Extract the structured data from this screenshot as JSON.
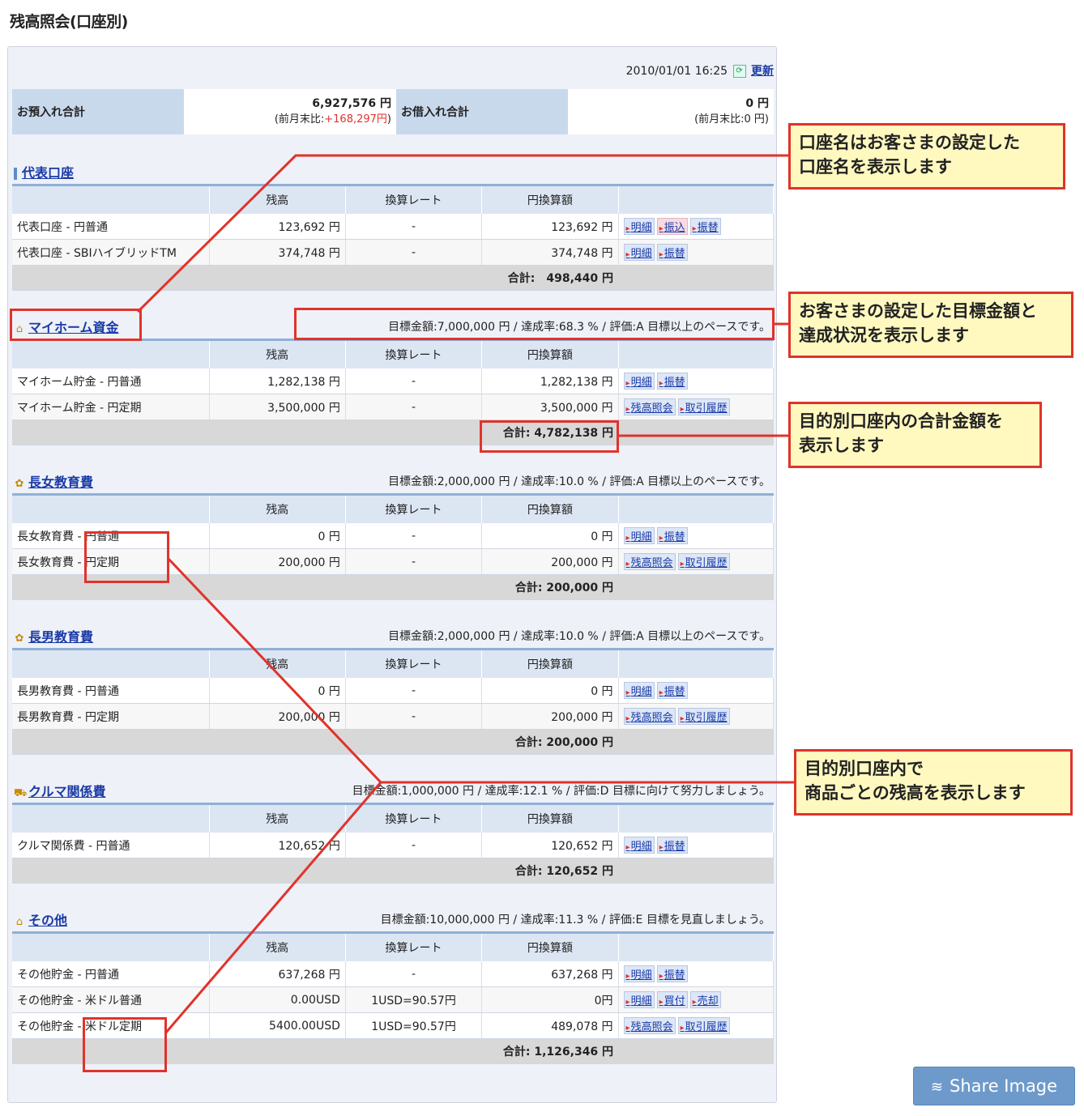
{
  "page": {
    "title": "残高照会(口座別)"
  },
  "topbar": {
    "datetime": "2010/01/01 16:25",
    "refresh_label": "更新"
  },
  "summary": {
    "deposit_label": "お預入れ合計",
    "deposit_value": "6,927,576 円",
    "deposit_change_prefix": "(前月末比:",
    "deposit_change": "+168,297円",
    "deposit_change_suffix": ")",
    "loan_label": "お借入れ合計",
    "loan_value": "0 円",
    "loan_change": "(前月末比:0 円)"
  },
  "columns": [
    "",
    "残高",
    "換算レート",
    "円換算額",
    ""
  ],
  "sections": [
    {
      "name": "代表口座",
      "icon": "bar-marker",
      "goal": "",
      "rows": [
        {
          "name": "代表口座 - 円普通",
          "balance": "123,692 円",
          "rate": "-",
          "yen": "123,692 円",
          "actions": [
            "明細",
            "振込",
            "振替"
          ]
        },
        {
          "name": "代表口座 - SBIハイブリッドTM",
          "balance": "374,748 円",
          "rate": "-",
          "yen": "374,748 円",
          "actions": [
            "明細",
            "振替"
          ]
        }
      ],
      "total": "合計:　498,440 円"
    },
    {
      "name": "マイホーム資金",
      "icon": "house-icon",
      "goal": "目標金額:7,000,000 円 / 達成率:68.3 % / 評価:A 目標以上のペースです。",
      "rows": [
        {
          "name": "マイホーム貯金 - 円普通",
          "balance": "1,282,138 円",
          "rate": "-",
          "yen": "1,282,138 円",
          "actions": [
            "明細",
            "振替"
          ]
        },
        {
          "name": "マイホーム貯金 - 円定期",
          "balance": "3,500,000 円",
          "rate": "-",
          "yen": "3,500,000 円",
          "actions": [
            "残高照会",
            "取引履歴"
          ]
        }
      ],
      "total": "合計: 4,782,138 円"
    },
    {
      "name": "長女教育費",
      "icon": "chick-icon",
      "goal": "目標金額:2,000,000 円 / 達成率:10.0 % / 評価:A 目標以上のペースです。",
      "rows": [
        {
          "name": "長女教育費 - 円普通",
          "balance": "0 円",
          "rate": "-",
          "yen": "0 円",
          "actions": [
            "明細",
            "振替"
          ]
        },
        {
          "name": "長女教育費 - 円定期",
          "balance": "200,000 円",
          "rate": "-",
          "yen": "200,000 円",
          "actions": [
            "残高照会",
            "取引履歴"
          ]
        }
      ],
      "total": "合計: 200,000 円"
    },
    {
      "name": "長男教育費",
      "icon": "chick-icon",
      "goal": "目標金額:2,000,000 円 / 達成率:10.0 % / 評価:A 目標以上のペースです。",
      "rows": [
        {
          "name": "長男教育費 - 円普通",
          "balance": "0 円",
          "rate": "-",
          "yen": "0 円",
          "actions": [
            "明細",
            "振替"
          ]
        },
        {
          "name": "長男教育費 - 円定期",
          "balance": "200,000 円",
          "rate": "-",
          "yen": "200,000 円",
          "actions": [
            "残高照会",
            "取引履歴"
          ]
        }
      ],
      "total": "合計: 200,000 円"
    },
    {
      "name": "クルマ関係費",
      "icon": "car-icon",
      "goal": "目標金額:1,000,000 円 / 達成率:12.1 % / 評価:D 目標に向けて努力しましょう。",
      "rows": [
        {
          "name": "クルマ関係費 - 円普通",
          "balance": "120,652 円",
          "rate": "-",
          "yen": "120,652 円",
          "actions": [
            "明細",
            "振替"
          ]
        }
      ],
      "total": "合計: 120,652 円"
    },
    {
      "name": "その他",
      "icon": "house-outline-icon",
      "goal": "目標金額:10,000,000 円 / 達成率:11.3 % / 評価:E 目標を見直しましょう。",
      "rows": [
        {
          "name": "その他貯金 - 円普通",
          "balance": "637,268 円",
          "rate": "-",
          "yen": "637,268 円",
          "actions": [
            "明細",
            "振替"
          ]
        },
        {
          "name": "その他貯金 - 米ドル普通",
          "balance": "0.00USD",
          "rate": "1USD=90.57円",
          "yen": "0円",
          "actions": [
            "明細",
            "買付",
            "売却"
          ]
        },
        {
          "name": "その他貯金 - 米ドル定期",
          "balance": "5400.00USD",
          "rate": "1USD=90.57円",
          "yen": "489,078 円",
          "actions": [
            "残高照会",
            "取引履歴"
          ]
        }
      ],
      "total": "合計: 1,126,346 円"
    }
  ],
  "callouts": {
    "c1": "口座名はお客さまの設定した\n口座名を表示します",
    "c2": "お客さまの設定した目標金額と\n達成状況を表示します",
    "c3": "目的別口座内の合計金額を\n表示します",
    "c4": "目的別口座内で\n商品ごとの残高を表示します"
  },
  "share": {
    "label": "Share Image"
  },
  "colors": {
    "annotation_red": "#e0332b",
    "callout_bg": "#fff9c0",
    "header_blue": "#c9d9ec"
  }
}
